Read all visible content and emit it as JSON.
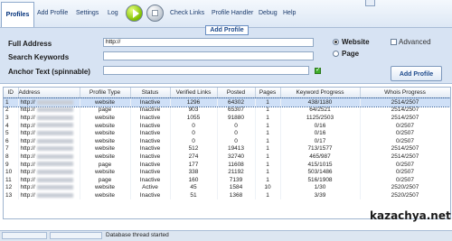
{
  "toolbar": {
    "items": [
      "Profiles",
      "Add Profile",
      "Settings",
      "Log",
      "Check Links",
      "Profile Handler",
      "Debug",
      "Help"
    ]
  },
  "form": {
    "legend": "Add Profile",
    "address_label": "Full Address",
    "address_value": "http://",
    "keywords_label": "Search Keywords",
    "keywords_value": "",
    "anchor_label": "Anchor Text (spinnable)",
    "anchor_value": "",
    "radio_website": "Website",
    "radio_page": "Page",
    "advanced_label": "Advanced",
    "add_button": "Add Profile"
  },
  "table": {
    "columns": [
      "ID",
      "Address",
      "Profile Type",
      "Status",
      "Verified Links",
      "Posted",
      "Pages",
      "Keyword Progress",
      "Whois Progress"
    ],
    "rows": [
      [
        "1",
        "http://",
        "website",
        "Inactive",
        "1296",
        "64302",
        "1",
        "438/1180",
        "2514/2507"
      ],
      [
        "2",
        "http://",
        "page",
        "Inactive",
        "903",
        "65307",
        "1",
        "64/2521",
        "2514/2507"
      ],
      [
        "3",
        "http://",
        "website",
        "Inactive",
        "1055",
        "91880",
        "1",
        "1125/2503",
        "2514/2507"
      ],
      [
        "4",
        "http://",
        "website",
        "Inactive",
        "0",
        "0",
        "1",
        "0/16",
        "0/2507"
      ],
      [
        "5",
        "http://",
        "website",
        "Inactive",
        "0",
        "0",
        "1",
        "0/16",
        "0/2507"
      ],
      [
        "6",
        "http://",
        "website",
        "Inactive",
        "0",
        "0",
        "1",
        "0/17",
        "0/2507"
      ],
      [
        "7",
        "http://",
        "website",
        "Inactive",
        "512",
        "19413",
        "1",
        "713/1577",
        "2514/2507"
      ],
      [
        "8",
        "http://",
        "website",
        "Inactive",
        "274",
        "32740",
        "1",
        "465/987",
        "2514/2507"
      ],
      [
        "9",
        "http://",
        "page",
        "Inactive",
        "177",
        "11608",
        "1",
        "415/1015",
        "0/2507"
      ],
      [
        "10",
        "http://",
        "website",
        "Inactive",
        "338",
        "21192",
        "1",
        "503/1486",
        "0/2507"
      ],
      [
        "11",
        "http://",
        "page",
        "Inactive",
        "160",
        "7139",
        "1",
        "516/1908",
        "0/2507"
      ],
      [
        "12",
        "http://",
        "website",
        "Active",
        "45",
        "1584",
        "10",
        "1/30",
        "2520/2507"
      ],
      [
        "13",
        "http://",
        "website",
        "Inactive",
        "51",
        "1368",
        "1",
        "3/39",
        "2520/2507"
      ]
    ],
    "selected_row": 0
  },
  "status": {
    "message": "Database thread started"
  },
  "watermark": "kazachya.net",
  "colors": {
    "play_button": "#7fbf00",
    "checkbox_green": "#3fae2a",
    "selection": "#cfe0f7"
  }
}
